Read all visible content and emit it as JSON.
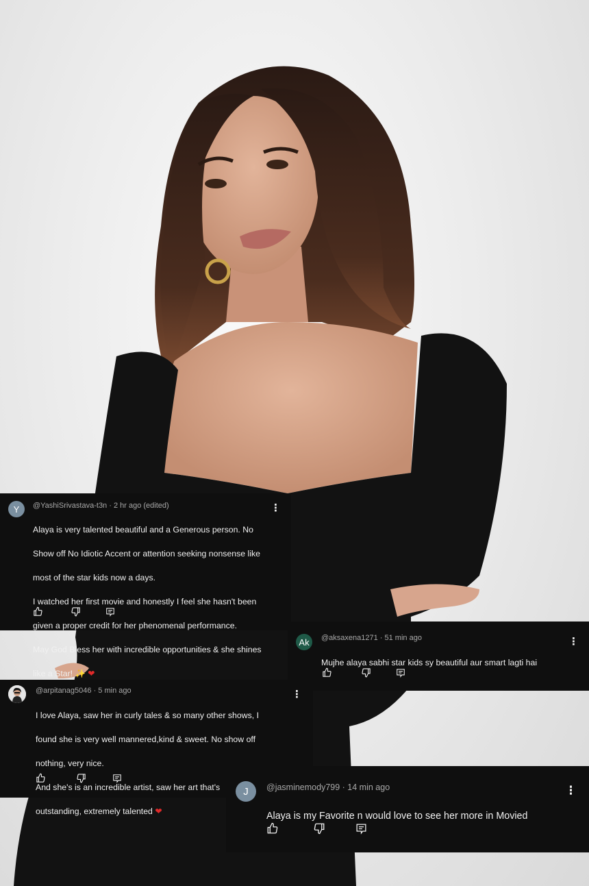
{
  "colors": {
    "card_bg": "#0f0f0f",
    "text": "#f1f1f1",
    "meta": "#aaaaaa",
    "heart": "#e02a2a"
  },
  "comments": [
    {
      "avatar_letter": "Y",
      "avatar_color": "#7a8fa0",
      "handle": "@YashiSrivastava-t3n",
      "time": "· 2 hr ago (edited)",
      "lines": [
        "Alaya is very talented beautiful and a Generous person. No",
        "Show off No Idiotic Accent or attention seeking nonsense like",
        "most of the star kids now a days.",
        "I watched her first movie and honestly I feel she hasn't been",
        "given a proper credit for her phenomenal performance.",
        "May God Bless her with incredible opportunities & she shines",
        "like a Star! ✨"
      ],
      "emoji": "❤"
    },
    {
      "avatar_letter": "Ak",
      "avatar_color": "#1f5a48",
      "handle": "@aksaxena1271",
      "time": "· 51 min ago",
      "lines": [
        "Mujhe alaya sabhi star kids sy beautiful aur smart lagti hai"
      ],
      "emoji": ""
    },
    {
      "avatar_letter": "",
      "avatar_color": "#d8d8d8",
      "handle": "@arpitanag5046",
      "time": "· 5 min ago",
      "lines": [
        "I love Alaya, saw her in curly tales & so many other shows, I",
        "found she is very well mannered,kind & sweet. No show off",
        "nothing, very nice.",
        "And she's is an incredible artist, saw her art that's",
        "outstanding, extremely talented"
      ],
      "emoji": "❤"
    },
    {
      "avatar_letter": "J",
      "avatar_color": "#7a8fa0",
      "handle": "@jasminemody799",
      "time": "· 14 min ago",
      "lines": [
        "Alaya is my Favorite n would love to see her more in Movied"
      ],
      "emoji": ""
    }
  ]
}
